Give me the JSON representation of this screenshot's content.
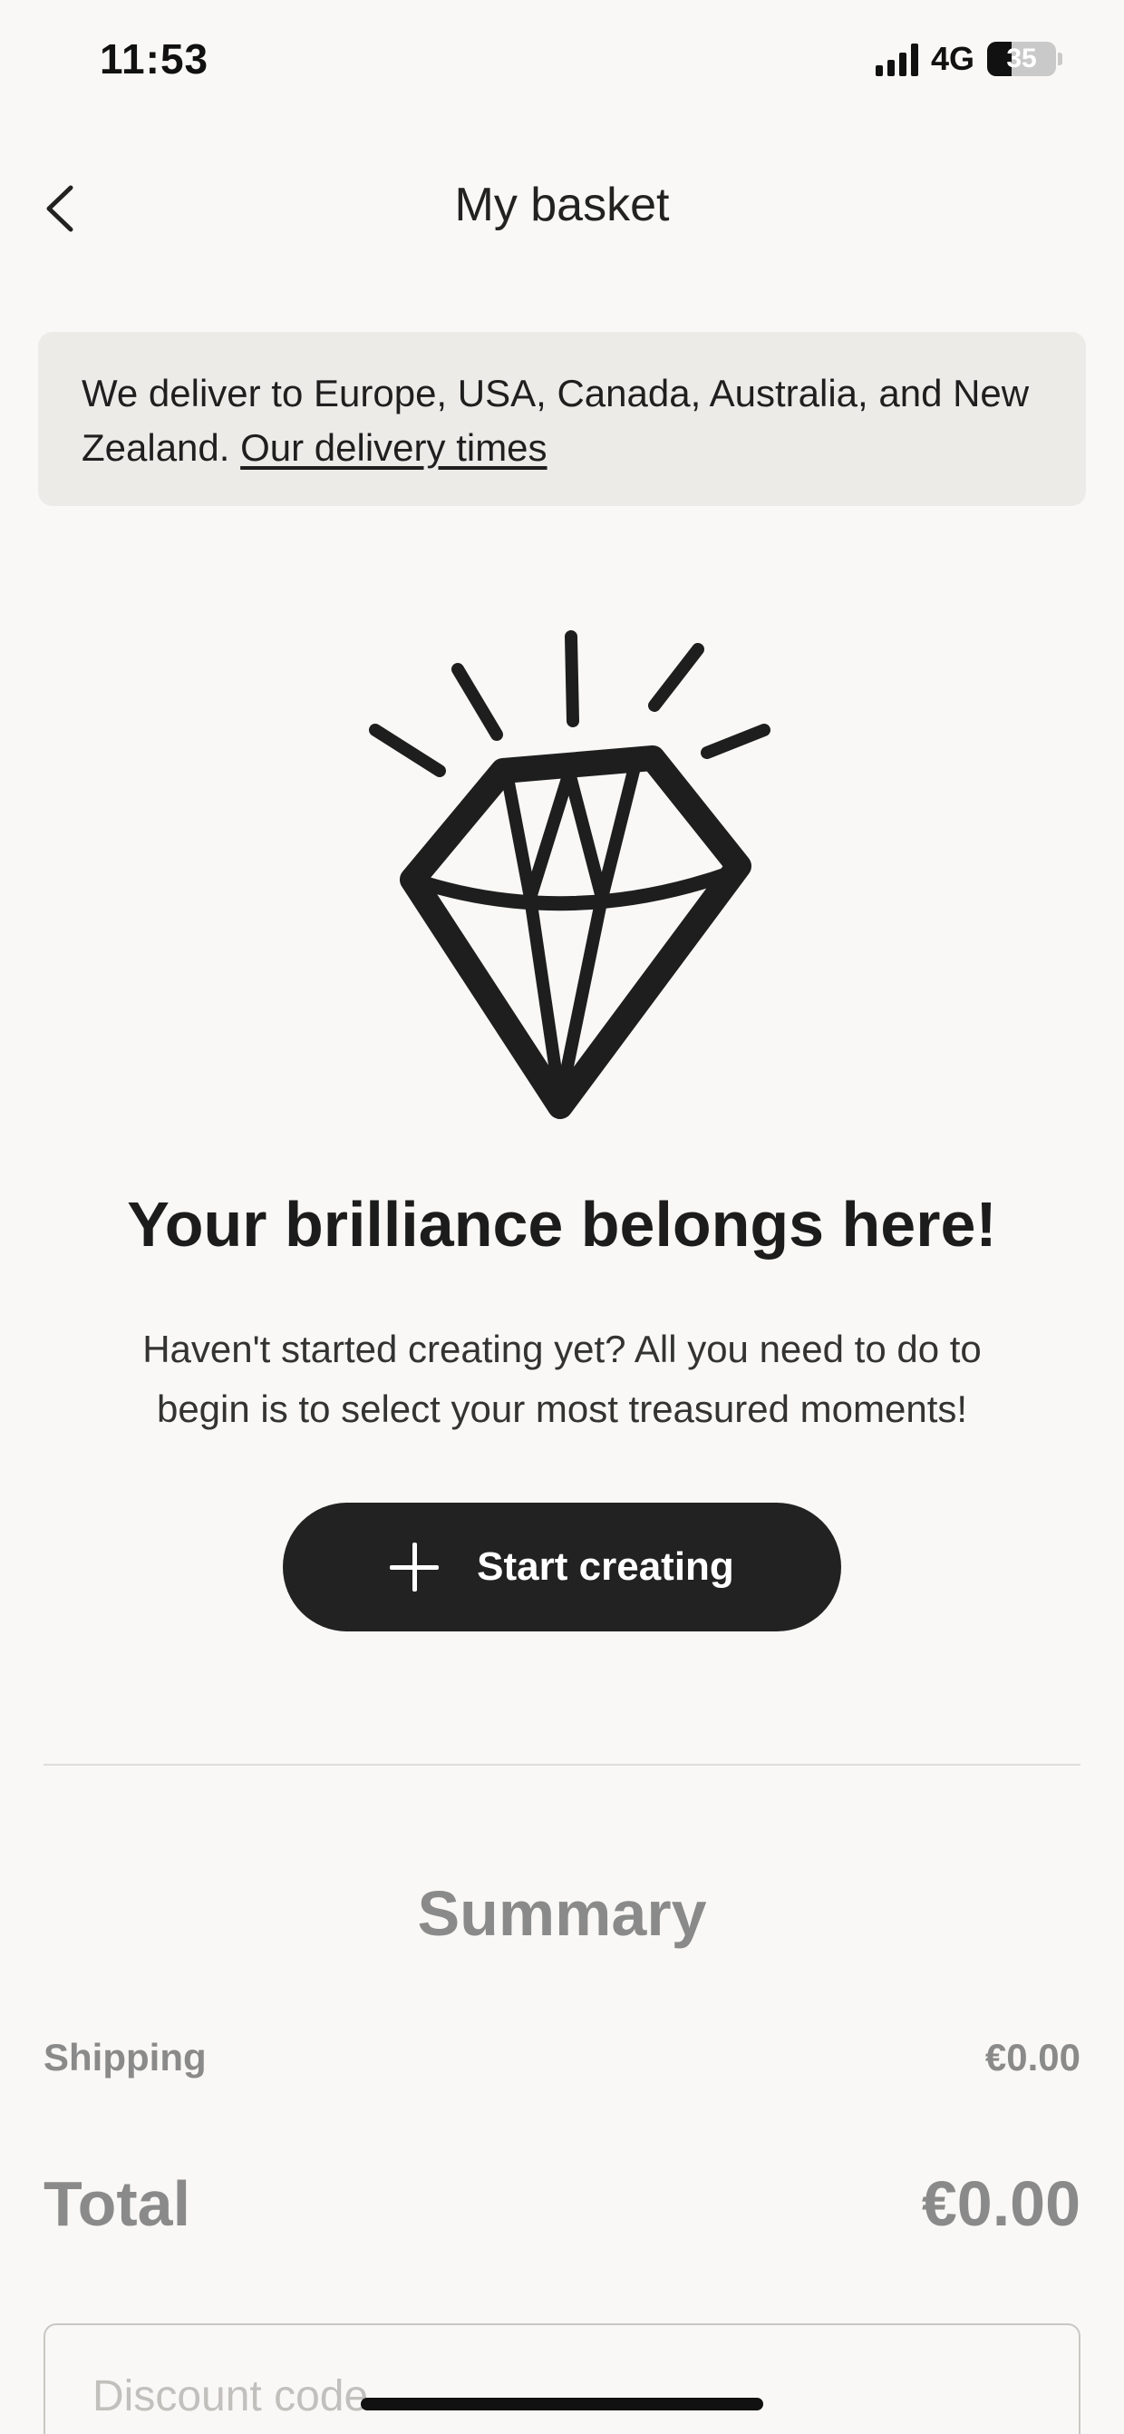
{
  "status_bar": {
    "time": "11:53",
    "network": "4G",
    "battery": "35",
    "battery_level_percent": 35
  },
  "header": {
    "back_icon": "chevron-left-icon",
    "title": "My basket"
  },
  "banner": {
    "text": "We deliver to Europe, USA, Canada, Australia, and New Zealand.",
    "link_label": "Our delivery times"
  },
  "empty_state": {
    "illustration": "diamond-icon",
    "headline": "Your brilliance belongs here!",
    "subtext": "Haven't started creating yet? All you need to do to begin is to select your most treasured moments!",
    "cta_icon": "plus-icon",
    "cta_label": "Start creating"
  },
  "summary": {
    "title": "Summary",
    "shipping_label": "Shipping",
    "shipping_value": "€0.00",
    "total_label": "Total",
    "total_value": "€0.00",
    "discount_placeholder": "Discount code",
    "discount_value": ""
  },
  "colors": {
    "background": "#f9f8f6",
    "banner": "#edebe7",
    "primary": "#222222",
    "muted": "#8a8a8a"
  }
}
